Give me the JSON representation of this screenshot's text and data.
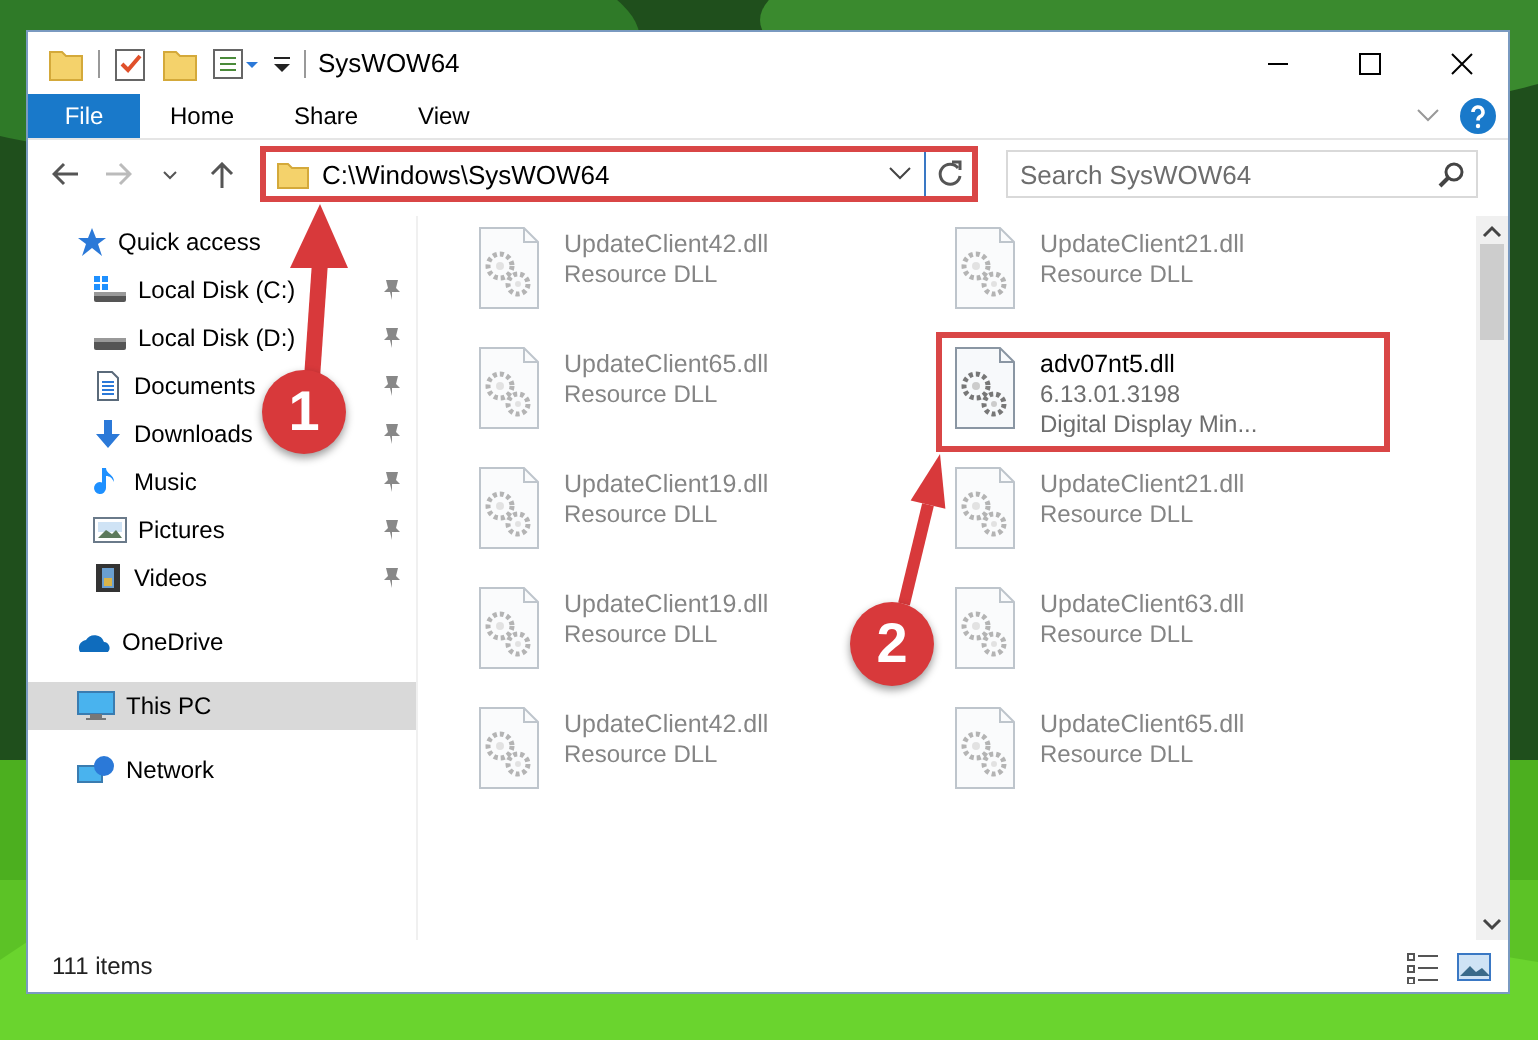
{
  "window": {
    "title": "SysWOW64"
  },
  "ribbon": [
    {
      "label": "File",
      "kind": "menu"
    },
    {
      "label": "Home",
      "kind": "tab"
    },
    {
      "label": "Share",
      "kind": "tab"
    },
    {
      "label": "View",
      "kind": "tab"
    }
  ],
  "address": {
    "path": "C:\\Windows\\SysWOW64",
    "highlighted": true
  },
  "search": {
    "placeholder": "Search SysWOW64"
  },
  "nav": [
    {
      "label": "Quick access",
      "selected": false,
      "pinned": false,
      "children": [
        {
          "label": "Local Disk (C:)",
          "selected": false,
          "pinned": true
        },
        {
          "label": "Local Disk (D:)",
          "selected": false,
          "pinned": true
        },
        {
          "label": "Documents",
          "selected": false,
          "pinned": true
        },
        {
          "label": "Downloads",
          "selected": false,
          "pinned": true
        },
        {
          "label": "Music",
          "selected": false,
          "pinned": true
        },
        {
          "label": "Pictures",
          "selected": false,
          "pinned": true
        },
        {
          "label": "Videos",
          "selected": false,
          "pinned": true
        }
      ]
    },
    {
      "label": "OneDrive",
      "selected": false,
      "pinned": false
    },
    {
      "label": "This PC",
      "selected": true,
      "pinned": false
    },
    {
      "label": "Network",
      "selected": false,
      "pinned": false
    }
  ],
  "files": [
    {
      "name": "UpdateClient42.dll",
      "detail": "Resource DLL",
      "dimmed": true,
      "highlighted": false
    },
    {
      "name": "UpdateClient21.dll",
      "detail": "Resource DLL",
      "dimmed": true,
      "highlighted": false
    },
    {
      "name": "UpdateClient65.dll",
      "detail": "Resource DLL",
      "dimmed": true,
      "highlighted": false
    },
    {
      "name": "adv07nt5.dll",
      "version": "6.13.01.3198",
      "detail": "Digital Display Min...",
      "dimmed": false,
      "highlighted": true
    },
    {
      "name": "UpdateClient19.dll",
      "detail": "Resource DLL",
      "dimmed": true,
      "highlighted": false
    },
    {
      "name": "UpdateClient21.dll",
      "detail": "Resource DLL",
      "dimmed": true,
      "highlighted": false
    },
    {
      "name": "UpdateClient19.dll",
      "detail": "Resource DLL",
      "dimmed": true,
      "highlighted": false
    },
    {
      "name": "UpdateClient63.dll",
      "detail": "Resource DLL",
      "dimmed": true,
      "highlighted": false
    },
    {
      "name": "UpdateClient42.dll",
      "detail": "Resource DLL",
      "dimmed": true,
      "highlighted": false
    },
    {
      "name": "UpdateClient65.dll",
      "detail": "Resource DLL",
      "dimmed": true,
      "highlighted": false
    }
  ],
  "status_bar": {
    "item_count": "111 items"
  },
  "annotations": [
    {
      "label": "1"
    },
    {
      "label": "2"
    }
  ]
}
